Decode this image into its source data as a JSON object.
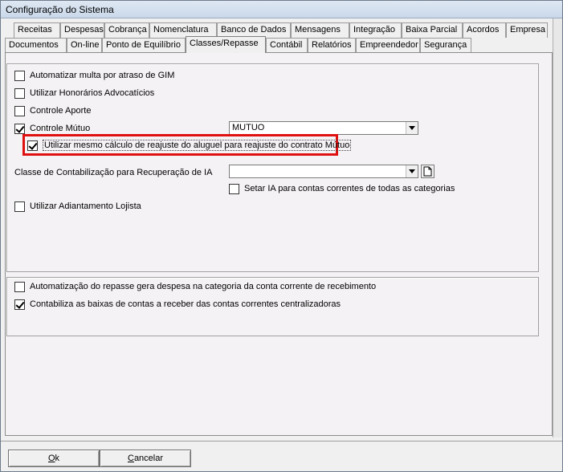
{
  "window": {
    "title": "Configuração do Sistema"
  },
  "tabs_row1": [
    "Receitas",
    "Despesas",
    "Cobrança",
    "Nomenclatura",
    "Banco de Dados",
    "Mensagens",
    "Integração",
    "Baixa Parcial",
    "Acordos",
    "Empresa"
  ],
  "tabs_row2": [
    "Documentos",
    "On-line",
    "Ponto de Equilíbrio",
    "Classes/Repasse",
    "Contábil",
    "Relatórios",
    "Empreendedor",
    "Segurança"
  ],
  "active_tab": "Classes/Repasse",
  "options": {
    "multa_gim": {
      "label": "Automatizar multa por atraso de GIM",
      "checked": false
    },
    "honorarios": {
      "label": "Utilizar Honorários Advocatícios",
      "checked": false
    },
    "aporte": {
      "label": "Controle Aporte",
      "checked": false
    },
    "mutuo": {
      "label": "Controle Mútuo",
      "checked": true,
      "combo_value": "MUTUO"
    },
    "reajuste": {
      "label": "Utilizar mesmo cálculo de reajuste do aluguel para reajuste do contrato Mútuo",
      "checked": true
    },
    "classe_ia_label": "Classe de Contabilização para Recuperação de IA",
    "classe_ia_value": "",
    "setar_ia": {
      "label": "Setar IA para contas correntes de todas as categorias",
      "checked": false
    },
    "adiantamento": {
      "label": "Utilizar Adiantamento Lojista",
      "checked": false
    }
  },
  "repasse": {
    "gera_despesa": {
      "label": "Automatização do repasse gera despesa na categoria da conta corrente de recebimento",
      "checked": false
    },
    "contabiliza": {
      "label": "Contabiliza as baixas de contas a receber das contas correntes centralizadoras",
      "checked": true
    }
  },
  "buttons": {
    "ok": "Ok",
    "cancel": "Cancelar"
  },
  "colors": {
    "highlight": "#e01010",
    "panel": "#f5f2f5"
  }
}
